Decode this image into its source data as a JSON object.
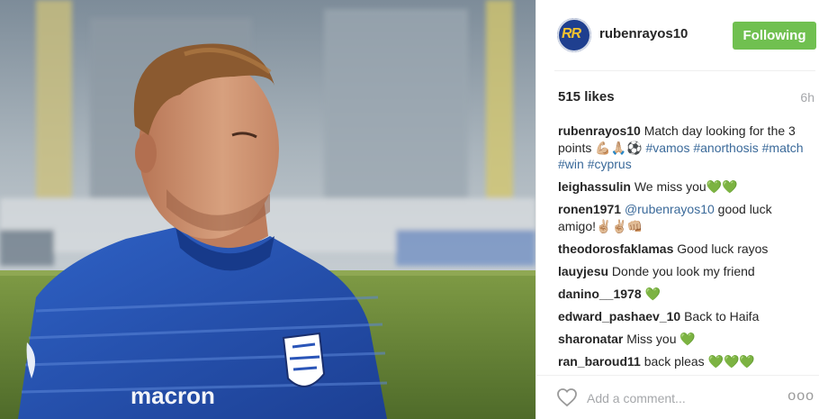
{
  "post": {
    "author": "rubenrayos10",
    "avatar_icon": "profile-avatar-rr-logo",
    "follow_label": "Following",
    "likes": "515 likes",
    "time": "6h",
    "caption": {
      "user": "rubenrayos10",
      "text": "Match day looking for the 3 points 💪🏼🙏🏼⚽",
      "hashtags": [
        "#vamos",
        "#anorthosis",
        "#match",
        "#win",
        "#cyprus"
      ]
    },
    "comments": [
      {
        "user": "leighassulin",
        "text": "We miss you",
        "emoji": "💚💚"
      },
      {
        "user": "ronen1971",
        "mention": "@rubenrayos10",
        "text": "good luck amigo!✌🏼✌🏼👊🏼"
      },
      {
        "user": "theodorosfaklamas",
        "text": "Good luck rayos"
      },
      {
        "user": "lauyjesu",
        "text": "Donde you look my friend"
      },
      {
        "user": "danino__1978",
        "text": "",
        "emoji": "💚"
      },
      {
        "user": "edward_pashaev_10",
        "text": "Back to Haifa"
      },
      {
        "user": "sharonatar",
        "text": "Miss you",
        "emoji": "💚"
      },
      {
        "user": "ran_baroud11",
        "text": "back pleas",
        "emoji": "💚💚💚"
      }
    ],
    "comment_placeholder": "Add a comment...",
    "more_label": "ooo"
  },
  "photo": {
    "jersey_sponsor": "macron",
    "subject": "footballer in blue striped jersey",
    "colors": {
      "jersey": "#2a55b8",
      "pitch": "#6b8a3a",
      "stands": "#9aa6b0",
      "skin": "#c98a6a",
      "hair": "#8a5a32"
    }
  },
  "colors": {
    "follow": "#70c050",
    "link": "#3b6a9a",
    "heart": "#3cb84a",
    "muted": "#a5a7aa"
  }
}
